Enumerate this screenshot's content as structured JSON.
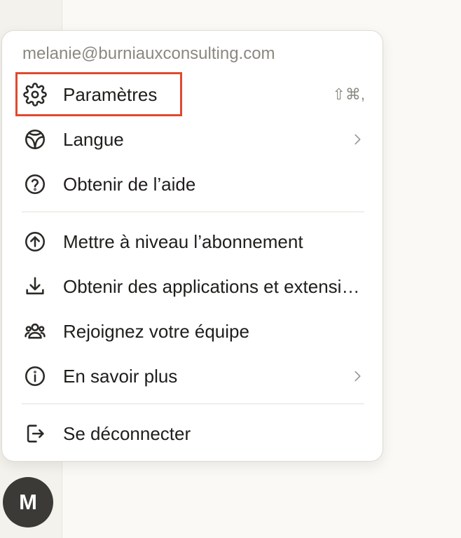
{
  "menu": {
    "email": "melanie@burniauxconsulting.com",
    "items": [
      {
        "label": "Paramètres",
        "icon": "gear-icon",
        "shortcut": "⇧⌘,",
        "submenu": false,
        "highlighted": true
      },
      {
        "label": "Langue",
        "icon": "globe-icon",
        "submenu": true
      },
      {
        "label": "Obtenir de l’aide",
        "icon": "help-circle-icon",
        "submenu": false
      },
      {
        "label": "Mettre à niveau l’abonnement",
        "icon": "arrow-up-circle-icon",
        "submenu": false
      },
      {
        "label": "Obtenir des applications et extensions",
        "icon": "download-icon",
        "submenu": false
      },
      {
        "label": "Rejoignez votre équipe",
        "icon": "users-icon",
        "submenu": false
      },
      {
        "label": "En savoir plus",
        "icon": "info-circle-icon",
        "submenu": true
      },
      {
        "label": "Se déconnecter",
        "icon": "logout-icon",
        "submenu": false
      }
    ]
  },
  "avatar": {
    "initial": "M"
  },
  "colors": {
    "highlight": "#e0492f",
    "avatar_bg": "#3b3a36"
  }
}
